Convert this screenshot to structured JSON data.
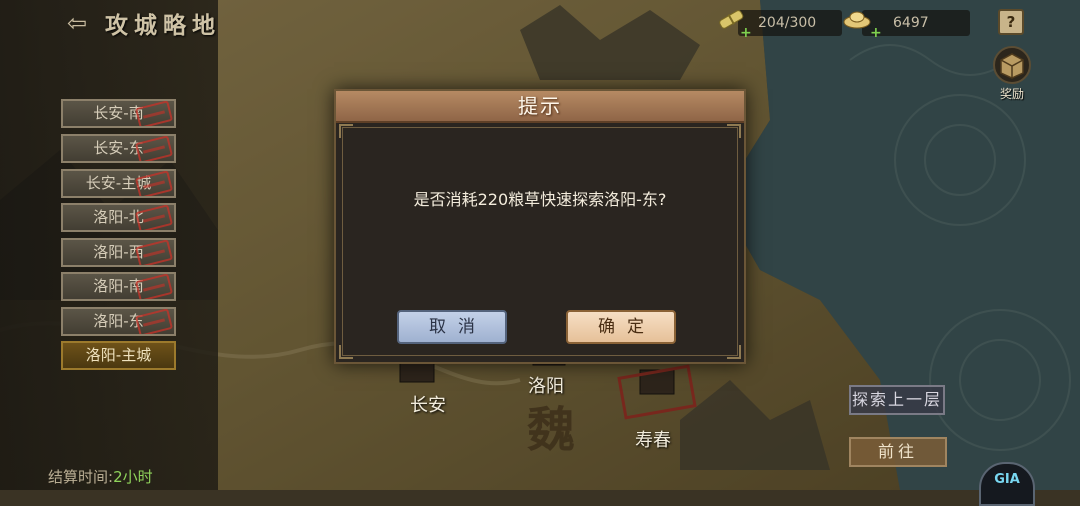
{
  "header": {
    "back_icon": "back-arrow-icon",
    "title": "攻城略地"
  },
  "resources": {
    "food": {
      "icon": "grain-bundle-icon",
      "value": "204/300"
    },
    "gold": {
      "icon": "gold-ingot-icon",
      "value": "6497"
    },
    "plus_glyph": "+"
  },
  "help": {
    "icon": "help-icon",
    "label": "?"
  },
  "reward": {
    "icon": "treasure-box-icon",
    "label": "奖励"
  },
  "locations": [
    {
      "label": "长安-南",
      "stamped": true
    },
    {
      "label": "长安-东",
      "stamped": true
    },
    {
      "label": "长安-主城",
      "stamped": true
    },
    {
      "label": "洛阳-北",
      "stamped": true
    },
    {
      "label": "洛阳-西",
      "stamped": true
    },
    {
      "label": "洛阳-南",
      "stamped": true
    },
    {
      "label": "洛阳-东",
      "stamped": true
    },
    {
      "label": "洛阳-主城",
      "stamped": false,
      "active": true
    }
  ],
  "settle": {
    "label": "结算时间:",
    "value": "2小时"
  },
  "map": {
    "cities": [
      "长安",
      "洛阳",
      "寿春"
    ],
    "kingdom": "魏"
  },
  "actions": {
    "explore_up": "探索上一层",
    "go": "前往"
  },
  "corner_logo": "GIA",
  "dialog": {
    "title": "提示",
    "message": "是否消耗220粮草快速探索洛阳-东?",
    "cancel": "取消",
    "confirm": "确定"
  },
  "colors": {
    "highlight_green": "#8fd35b",
    "active_gold": "#6e5219",
    "dialog_header": "#b68a63"
  }
}
